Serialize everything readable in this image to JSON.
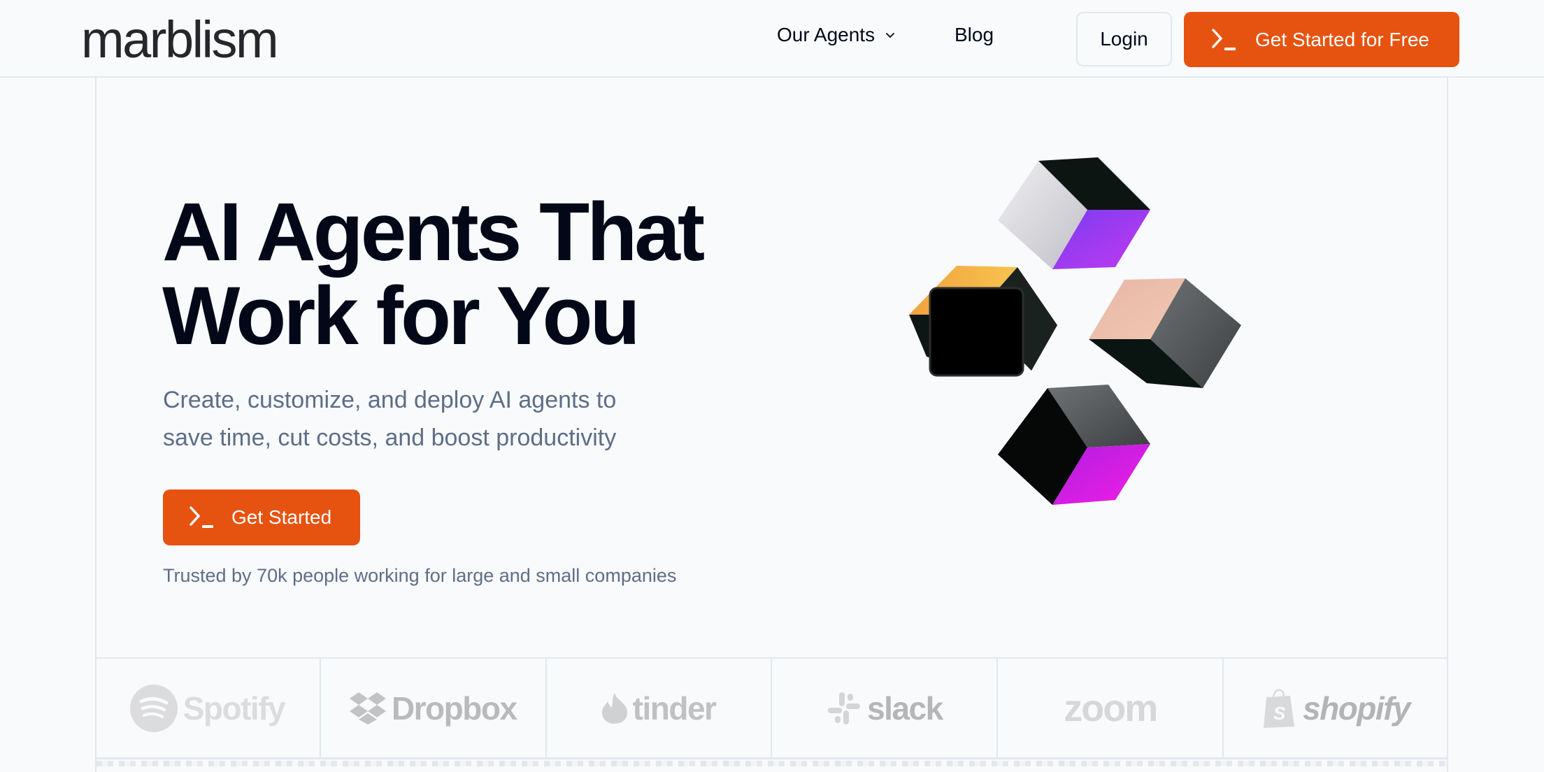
{
  "header": {
    "logo": "marblism",
    "nav": [
      {
        "label": "Our Agents",
        "has_dropdown": true
      },
      {
        "label": "Blog",
        "has_dropdown": false
      }
    ],
    "login_label": "Login",
    "cta_label": "Get Started for Free",
    "cta_icon": "terminal-prompt-icon"
  },
  "hero": {
    "title_line1": "AI Agents That",
    "title_line2": "Work for You",
    "subtitle_line1": "Create, customize, and deploy AI agents to",
    "subtitle_line2": "save time, cut costs, and boost productivity",
    "button_label": "Get Started",
    "button_icon": "terminal-prompt-icon",
    "trusted_text": "Trusted by 70k people working for large and small companies",
    "illustration": "floating-iridescent-cubes"
  },
  "logos": [
    {
      "name": "Spotify",
      "icon": "spotify-icon"
    },
    {
      "name": "Dropbox",
      "icon": "dropbox-icon"
    },
    {
      "name": "tinder",
      "icon": "tinder-flame-icon"
    },
    {
      "name": "slack",
      "icon": "slack-icon"
    },
    {
      "name": "zoom",
      "icon": ""
    },
    {
      "name": "shopify",
      "icon": "shopify-bag-icon"
    }
  ],
  "colors": {
    "accent": "#e65310",
    "text_primary": "#020817",
    "text_muted": "#5d6e86",
    "border": "#e2e8f0",
    "background": "#f8fafc",
    "logo_gray": "#b9babc"
  }
}
